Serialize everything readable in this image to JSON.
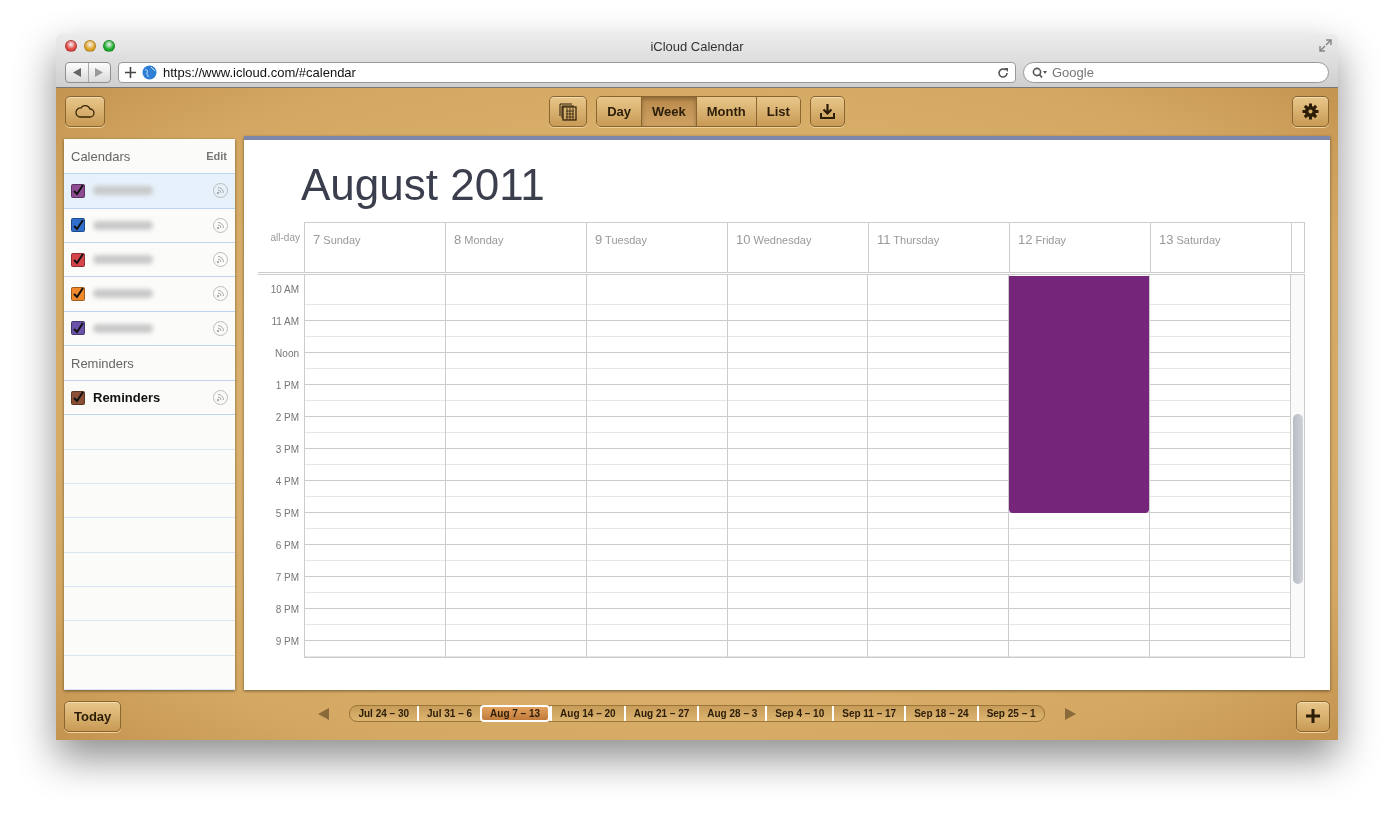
{
  "window": {
    "title": "iCloud Calendar"
  },
  "browser": {
    "url": "https://www.icloud.com/#calendar",
    "search": {
      "placeholder": "Google"
    }
  },
  "view_tabs": [
    {
      "label": "Day",
      "selected": false
    },
    {
      "label": "Week",
      "selected": true
    },
    {
      "label": "Month",
      "selected": false
    },
    {
      "label": "List",
      "selected": false
    }
  ],
  "sidebar": {
    "calendars_heading": "Calendars",
    "edit_label": "Edit",
    "calendars": [
      {
        "color": "#8e4a93",
        "checked": true,
        "selected": true
      },
      {
        "color": "#2f6fce",
        "checked": true,
        "selected": false
      },
      {
        "color": "#d6454a",
        "checked": true,
        "selected": false
      },
      {
        "color": "#f08a2c",
        "checked": true,
        "selected": false
      },
      {
        "color": "#6a52a8",
        "checked": true,
        "selected": false
      }
    ],
    "reminders_heading": "Reminders",
    "reminder_lists": [
      {
        "name": "Reminders",
        "color": "#8a4f35",
        "checked": true,
        "selected": false
      }
    ]
  },
  "calendar": {
    "title": "August 2011",
    "all_day_label": "all-day",
    "days": [
      {
        "number": "7",
        "name": "Sunday",
        "has_event": false
      },
      {
        "number": "8",
        "name": "Monday",
        "has_event": false
      },
      {
        "number": "9",
        "name": "Tuesday",
        "has_event": false
      },
      {
        "number": "10",
        "name": "Wednesday",
        "has_event": false
      },
      {
        "number": "11",
        "name": "Thursday",
        "has_event": false
      },
      {
        "number": "12",
        "name": "Friday",
        "has_event": true
      },
      {
        "number": "13",
        "name": "Saturday",
        "has_event": false
      }
    ],
    "hours": [
      "10 AM",
      "11 AM",
      "Noon",
      "1 PM",
      "2 PM",
      "3 PM",
      "4 PM",
      "5 PM",
      "6 PM",
      "7 PM",
      "8 PM",
      "9 PM"
    ]
  },
  "bottom_bar": {
    "today_label": "Today",
    "weeks": [
      {
        "label": "Jul 24 – 30",
        "selected": false
      },
      {
        "label": "Jul 31 – 6",
        "selected": false
      },
      {
        "label": "Aug 7 – 13",
        "selected": true
      },
      {
        "label": "Aug 14 – 20",
        "selected": false
      },
      {
        "label": "Aug 21 – 27",
        "selected": false
      },
      {
        "label": "Aug 28 – 3",
        "selected": false
      },
      {
        "label": "Sep 4 – 10",
        "selected": false
      },
      {
        "label": "Sep 11 – 17",
        "selected": false
      },
      {
        "label": "Sep 18 – 24",
        "selected": false
      },
      {
        "label": "Sep 25 – 1",
        "selected": false
      }
    ]
  }
}
